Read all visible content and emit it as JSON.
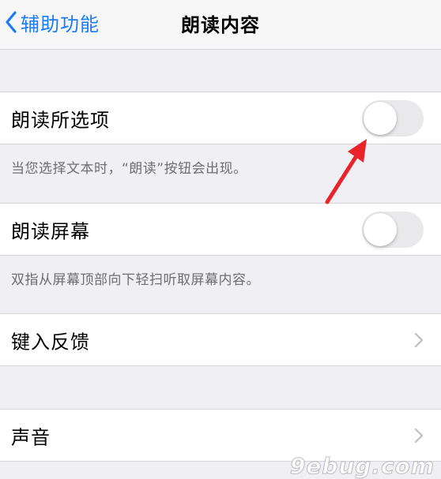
{
  "navbar": {
    "back_label": "辅助功能",
    "title": "朗读内容"
  },
  "sections": {
    "speak_selection": {
      "label": "朗读所选项",
      "on": false,
      "footer": "当您选择文本时，“朗读”按钮会出现。"
    },
    "speak_screen": {
      "label": "朗读屏幕",
      "on": false,
      "footer": "双指从屏幕顶部向下轻扫听取屏幕内容。"
    },
    "typing_feedback": {
      "label": "键入反馈"
    },
    "voices": {
      "label": "声音"
    }
  },
  "colors": {
    "accent": "#1a7cf5",
    "background": "#efeff4",
    "switch_off": "#e9e9eb",
    "annotation_arrow": "#e8232a"
  },
  "icons": {
    "back": "chevron-left-icon",
    "disclosure": "chevron-right-icon"
  },
  "watermark": "9ebug.com"
}
